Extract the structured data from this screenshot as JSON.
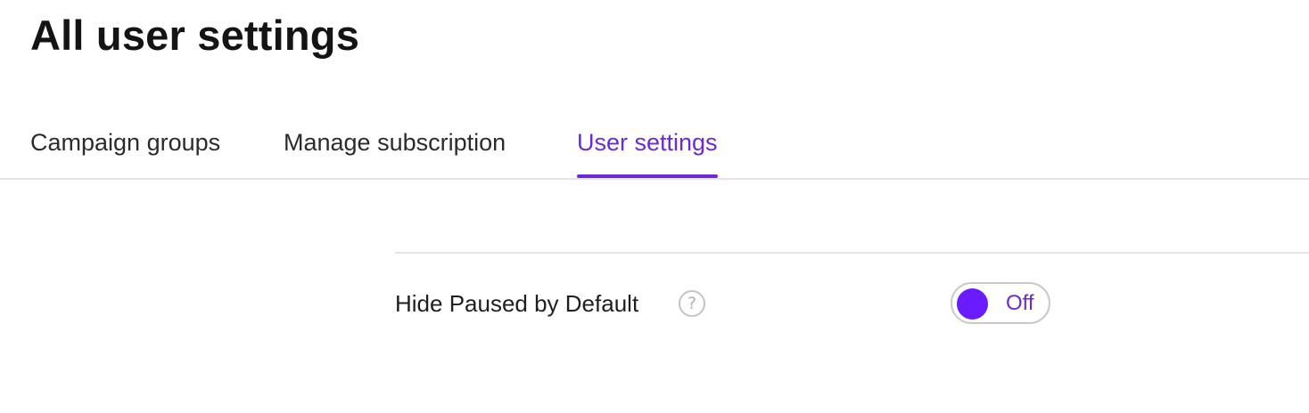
{
  "page": {
    "title": "All user settings"
  },
  "tabs": [
    {
      "label": "Campaign groups",
      "active": false
    },
    {
      "label": "Manage subscription",
      "active": false
    },
    {
      "label": "User settings",
      "active": true
    }
  ],
  "settings": [
    {
      "label": "Hide Paused by Default",
      "help_icon": "question-circle-icon",
      "help_glyph": "?",
      "toggle_state": "Off"
    }
  ],
  "colors": {
    "accent": "#6d28d9",
    "toggle_knob": "#6a1bff",
    "divider": "#e4e4e7"
  }
}
